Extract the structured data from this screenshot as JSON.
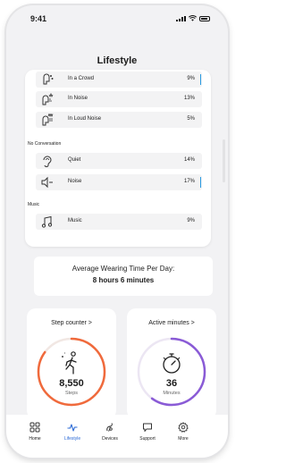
{
  "status_bar": {
    "time": "9:41"
  },
  "header": {
    "title": "Lifestyle"
  },
  "environment": {
    "rows_top": [
      {
        "label": "In a Crowd",
        "percent": "9%",
        "icon": "crowd-icon",
        "bar": true
      },
      {
        "label": "In Noise",
        "percent": "13%",
        "icon": "noise-speech-icon",
        "bar": false
      },
      {
        "label": "In Loud Noise",
        "percent": "5%",
        "icon": "loud-noise-speech-icon",
        "bar": false
      }
    ],
    "no_conversation_label": "No Conversation",
    "rows_no_conv": [
      {
        "label": "Quiet",
        "percent": "14%",
        "icon": "ear-icon",
        "bar": false
      },
      {
        "label": "Noise",
        "percent": "17%",
        "icon": "noise-icon",
        "bar": true
      }
    ],
    "music_label": "Music",
    "rows_music": [
      {
        "label": "Music",
        "percent": "9%",
        "icon": "music-note-icon",
        "bar": false
      }
    ]
  },
  "wearing": {
    "label": "Average Wearing Time Per Day:",
    "value": "8 hours 6 minutes"
  },
  "steps": {
    "title": "Step counter >",
    "value": "8,550",
    "unit": "Steps",
    "progress": 0.85,
    "color": "#f06a3c"
  },
  "active": {
    "title": "Active minutes >",
    "value": "36",
    "unit": "Minutes",
    "progress": 0.6,
    "color": "#8a5bd6"
  },
  "tabs": [
    {
      "label": "Home",
      "icon": "grid-icon"
    },
    {
      "label": "Lifestyle",
      "icon": "pulse-icon",
      "active": true
    },
    {
      "label": "Devices",
      "icon": "hearing-aid-icon"
    },
    {
      "label": "Support",
      "icon": "chat-icon"
    },
    {
      "label": "More",
      "icon": "gear-icon"
    }
  ],
  "colors": {
    "accent": "#2d6bd6",
    "bar": "#2b9ae0"
  }
}
